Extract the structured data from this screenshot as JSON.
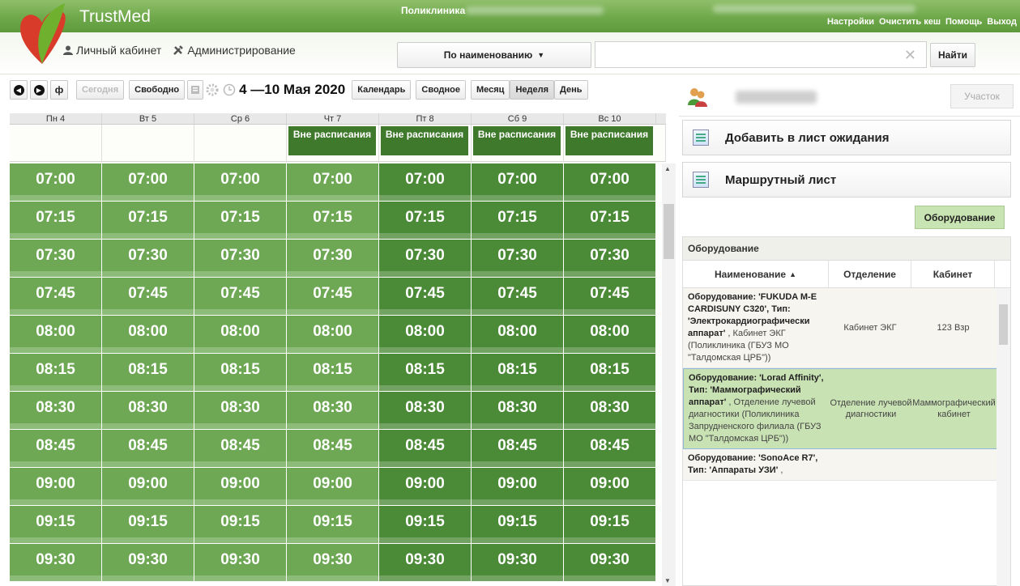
{
  "header": {
    "app_title": "TrustMed",
    "org": "Поликлиника",
    "top_links": [
      "Настройки",
      "Очистить кеш",
      "Помощь",
      "Выход"
    ],
    "nav": {
      "cabinet": "Личный кабинет",
      "admin": "Администрирование"
    },
    "search_mode": "По наименованию",
    "search_value": "",
    "find_button": "Найти"
  },
  "toolbar": {
    "today": "Сегодня",
    "free": "Свободно",
    "date_range": "4 —10 Мая 2020",
    "calendar": "Календарь",
    "summary": "Сводное",
    "month": "Месяц",
    "week": "Неделя",
    "day": "День"
  },
  "calendar": {
    "days": [
      "Пн 4",
      "Вт 5",
      "Ср 6",
      "Чт 7",
      "Пт 8",
      "Сб 9",
      "Вс 10"
    ],
    "off_schedule_label": "Вне расписания",
    "off_schedule_days": [
      false,
      false,
      false,
      true,
      true,
      true,
      true
    ],
    "times": [
      "07:00",
      "07:15",
      "07:30",
      "07:45",
      "08:00",
      "08:15",
      "08:30",
      "08:45",
      "09:00",
      "09:15",
      "09:30"
    ],
    "dark_days": [
      false,
      false,
      false,
      false,
      true,
      true,
      true
    ]
  },
  "right_panel": {
    "uchastok": "Участок",
    "add_waitlist": "Добавить в лист ожидания",
    "route_sheet": "Маршрутный лист",
    "equipment_button": "Оборудование",
    "equipment_title": "Оборудование",
    "columns": [
      "Наименование",
      "Отделение",
      "Кабинет"
    ],
    "rows": [
      {
        "bold": "Оборудование: 'FUKUDA M-E CARDISUNY C320', Тип: 'Электрокардиографически аппарат'",
        "rest": " , Кабинет ЭКГ (Поликлиника (ГБУЗ МО \"Талдомская ЦРБ\"))",
        "department": "Кабинет ЭКГ",
        "room": "123 Взр",
        "selected": false
      },
      {
        "bold": "Оборудование: 'Lorad Affinity', Тип: 'Маммографический аппарат'",
        "rest": " , Отделение лучевой диагностики (Поликлиника Запрудненского филиала (ГБУЗ МО \"Талдомская ЦРБ\"))",
        "department": "Отделение лучевой диагностики",
        "room": "Маммографический кабинет",
        "selected": true
      },
      {
        "bold": "Оборудование: 'SonoAce R7', Тип: 'Аппараты УЗИ'",
        "rest": " ,",
        "department": "",
        "room": "",
        "selected": false
      }
    ]
  },
  "colors": {
    "slot_light": "#6ea855",
    "slot_dark": "#4b8a36",
    "header_green": "#6ea84a",
    "selected_row": "#c9e2b4"
  }
}
